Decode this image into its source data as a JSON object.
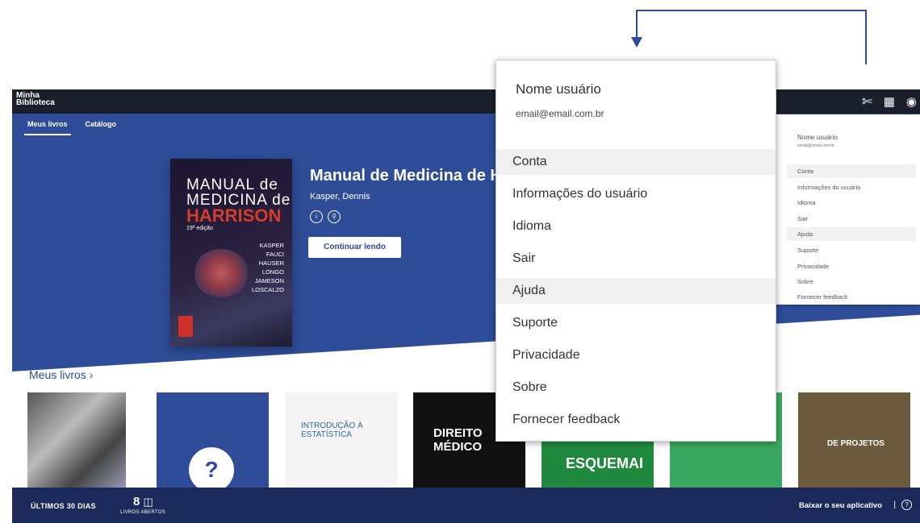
{
  "app": {
    "logo": "Minha\nBiblioteca",
    "logo_line1": "Minha",
    "logo_line2": "Biblioteca",
    "tabs": [
      {
        "label": "Meus livros"
      },
      {
        "label": "Catálogo"
      }
    ]
  },
  "hero": {
    "book_title": "Manual de Medicina de Harrison",
    "author": "Kasper, Dennis",
    "continue_label": "Continuar lendo",
    "cover": {
      "line1": "MANUAL de",
      "line2": "MEDICINA de",
      "line3": "HARRISON",
      "edition": "19ª edição",
      "authors": [
        "KASPER",
        "FAUCI",
        "HAUSER",
        "LONGO",
        "JAMESON",
        "LOSCALZO"
      ]
    }
  },
  "shelf": {
    "heading": "Meus livros",
    "books": [
      {
        "title": ""
      },
      {
        "title": ""
      },
      {
        "title": "INTRODUÇÃO À ESTATÍSTICA"
      },
      {
        "title": "DIREITO MÉDICO"
      },
      {
        "title": "ESQUEMAI"
      },
      {
        "title": ""
      },
      {
        "title": "DE PROJETOS"
      }
    ]
  },
  "bottom": {
    "period_label": "ÚLTIMOS 30 DIAS",
    "count": "8",
    "count_sub": "LIVROS ABERTOS",
    "download_label": "Baixar o seu aplicativo",
    "separator": "|"
  },
  "menu": {
    "user_name": "Nome usuário",
    "email": "email@email.com.br",
    "items": [
      {
        "label": "Conta",
        "group": true
      },
      {
        "label": "Informações do usuário",
        "group": false
      },
      {
        "label": "Idioma",
        "group": false
      },
      {
        "label": "Sair",
        "group": false
      },
      {
        "label": "Ajuda",
        "group": true
      },
      {
        "label": "Suporte",
        "group": false
      },
      {
        "label": "Privacidade",
        "group": false
      },
      {
        "label": "Sobre",
        "group": false
      },
      {
        "label": "Fornecer feedback",
        "group": false
      }
    ]
  },
  "small_menu": {
    "user_name": "Nome usuário",
    "email": "email@email.com.br",
    "items": [
      {
        "label": "Conta"
      },
      {
        "label": "Informações do usuário"
      },
      {
        "label": "Idioma"
      },
      {
        "label": "Sair"
      },
      {
        "label": "Ajuda"
      },
      {
        "label": "Suporte"
      },
      {
        "label": "Privacidade"
      },
      {
        "label": "Sobre"
      },
      {
        "label": "Fornecer feedback"
      }
    ]
  },
  "colors": {
    "brand_blue": "#2e4c97",
    "topbar": "#1b1f2c",
    "bottombar": "#1b2a5a"
  }
}
